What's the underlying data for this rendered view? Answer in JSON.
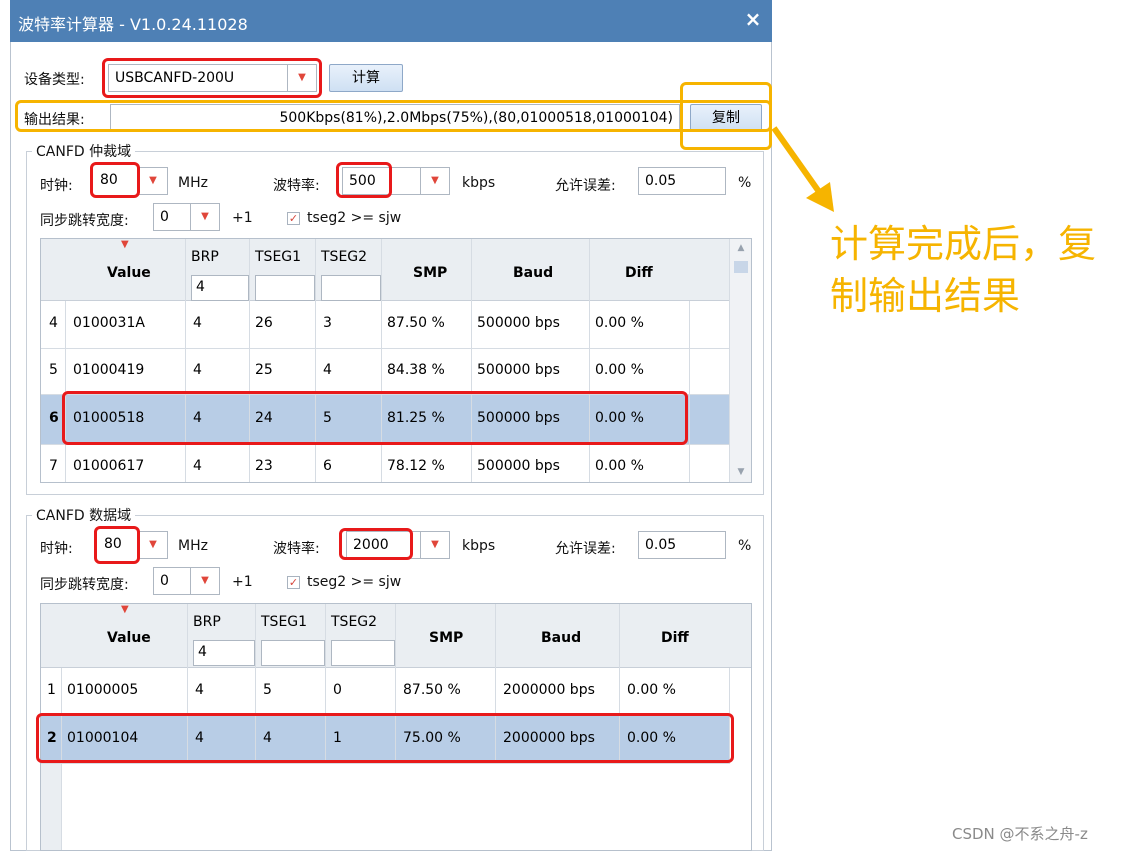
{
  "window": {
    "title": "波特率计算器 - V1.0.24.11028",
    "close": "×"
  },
  "device": {
    "label": "设备类型:",
    "value": "USBCANFD-200U",
    "calc_button": "计算"
  },
  "output": {
    "label": "输出结果:",
    "value": "500Kbps(81%),2.0Mbps(75%),(80,01000518,01000104)",
    "copy_button": "复制"
  },
  "arb": {
    "title": "CANFD 仲裁域",
    "clock_label": "时钟:",
    "clock_value": "80",
    "clock_unit": "MHz",
    "baud_label": "波特率:",
    "baud_value": "500",
    "baud_unit": "kbps",
    "tol_label": "允许误差:",
    "tol_value": "0.05",
    "tol_unit": "%",
    "sjw_label": "同步跳转宽度:",
    "sjw_value": "0",
    "sjw_plus": "+1",
    "check_label": "tseg2 >= sjw",
    "headers": {
      "value": "Value",
      "brp": "BRP",
      "brp_filter": "4",
      "tseg1": "TSEG1",
      "tseg2": "TSEG2",
      "smp": "SMP",
      "baud": "Baud",
      "diff": "Diff"
    },
    "rows": [
      {
        "idx": "4",
        "value": "0100031A",
        "brp": "4",
        "tseg1": "26",
        "tseg2": "3",
        "smp": "87.50 %",
        "baud": "500000 bps",
        "diff": "0.00 %"
      },
      {
        "idx": "5",
        "value": "01000419",
        "brp": "4",
        "tseg1": "25",
        "tseg2": "4",
        "smp": "84.38 %",
        "baud": "500000 bps",
        "diff": "0.00 %"
      },
      {
        "idx": "6",
        "value": "01000518",
        "brp": "4",
        "tseg1": "24",
        "tseg2": "5",
        "smp": "81.25 %",
        "baud": "500000 bps",
        "diff": "0.00 %"
      },
      {
        "idx": "7",
        "value": "01000617",
        "brp": "4",
        "tseg1": "23",
        "tseg2": "6",
        "smp": "78.12 %",
        "baud": "500000 bps",
        "diff": "0.00 %"
      }
    ]
  },
  "data": {
    "title": "CANFD 数据域",
    "clock_label": "时钟:",
    "clock_value": "80",
    "clock_unit": "MHz",
    "baud_label": "波特率:",
    "baud_value": "2000",
    "baud_unit": "kbps",
    "tol_label": "允许误差:",
    "tol_value": "0.05",
    "tol_unit": "%",
    "sjw_label": "同步跳转宽度:",
    "sjw_value": "0",
    "sjw_plus": "+1",
    "check_label": "tseg2 >= sjw",
    "headers": {
      "value": "Value",
      "brp": "BRP",
      "brp_filter": "4",
      "tseg1": "TSEG1",
      "tseg2": "TSEG2",
      "smp": "SMP",
      "baud": "Baud",
      "diff": "Diff"
    },
    "rows": [
      {
        "idx": "1",
        "value": "01000005",
        "brp": "4",
        "tseg1": "5",
        "tseg2": "0",
        "smp": "87.50 %",
        "baud": "2000000 bps",
        "diff": "0.00 %"
      },
      {
        "idx": "2",
        "value": "01000104",
        "brp": "4",
        "tseg1": "4",
        "tseg2": "1",
        "smp": "75.00 %",
        "baud": "2000000 bps",
        "diff": "0.00 %"
      }
    ]
  },
  "annotation": {
    "line1": "计算完成后，复",
    "line2": "制输出结果"
  },
  "watermark": "CSDN @不系之舟-z",
  "colors": {
    "titlebar": "#4e80b5",
    "selected_row": "#b8cde6",
    "highlight_red": "#e8191a",
    "highlight_yellow": "#f6b400"
  }
}
